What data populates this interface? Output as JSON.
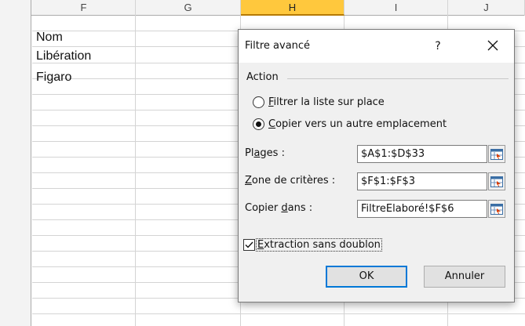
{
  "spreadsheet": {
    "columns": [
      "F",
      "G",
      "H",
      "I",
      "J"
    ],
    "selected_column": "H",
    "cells": {
      "F": [
        "Nom",
        "Libération",
        "Figaro"
      ]
    }
  },
  "dialog": {
    "title": "Filtre avancé",
    "help_label": "?",
    "action_section_label": "Action",
    "radio_filter_in_place": {
      "label_accel": "F",
      "label_rest": "iltrer la liste sur place",
      "checked": false
    },
    "radio_copy_elsewhere": {
      "label_accel": "C",
      "label_rest": "opier vers un autre emplacement",
      "checked": true
    },
    "list_range": {
      "label_pre": "Pl",
      "label_accel": "a",
      "label_post": "ges :",
      "value": "$A$1:$D$33"
    },
    "criteria_range": {
      "label_accel": "Z",
      "label_rest": "one de critères :",
      "value": "$F$1:$F$3"
    },
    "copy_to": {
      "label_pre": "Copier ",
      "label_accel": "d",
      "label_post": "ans :",
      "value": "FiltreElaboré!$F$6"
    },
    "unique_records": {
      "label_accel": "E",
      "label_rest": "xtraction sans doublon",
      "checked": true
    },
    "ok_label": "OK",
    "cancel_label": "Annuler"
  }
}
